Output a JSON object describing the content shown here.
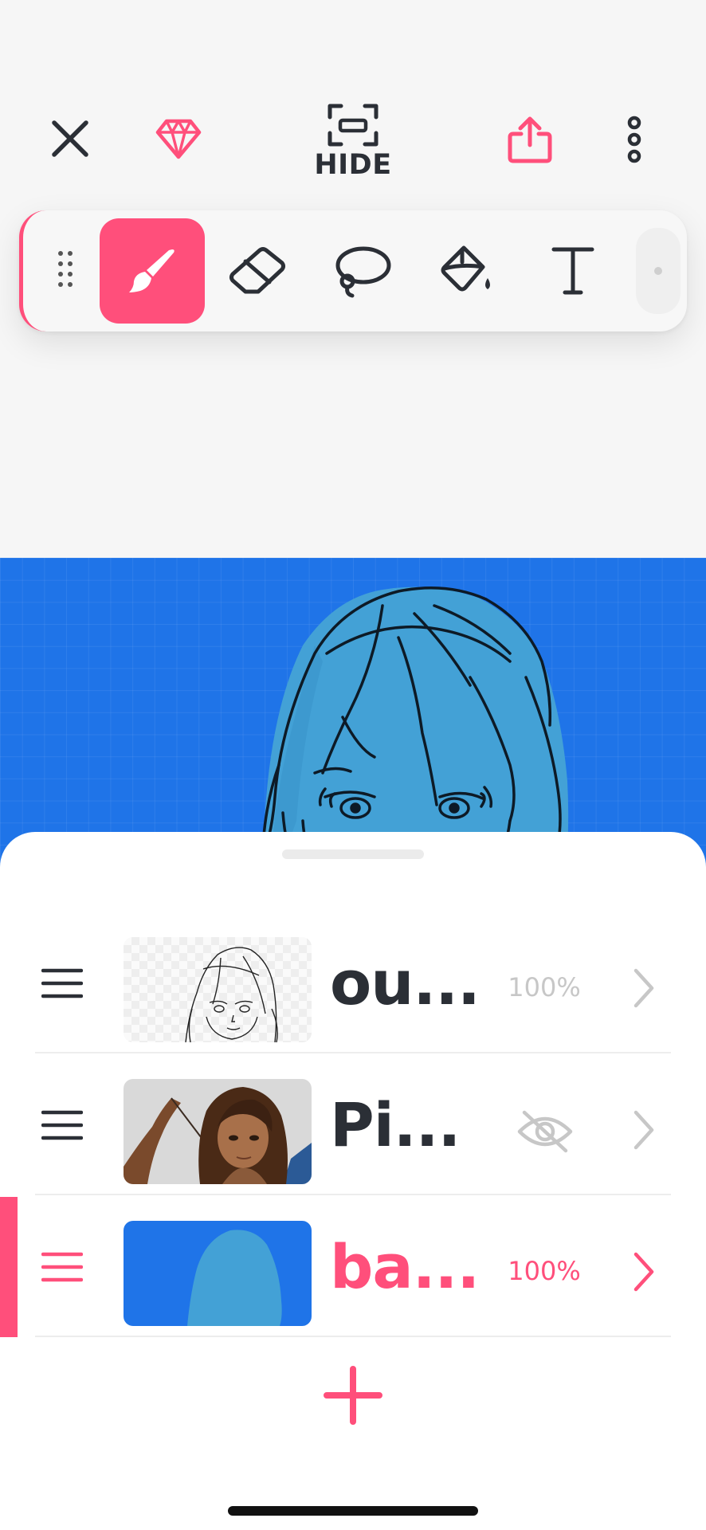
{
  "topbar": {
    "close_icon": "close-icon",
    "premium_icon": "diamond-icon",
    "hide_icon": "fullscreen-icon",
    "hide_label": "HIDE",
    "share_icon": "share-icon",
    "more_icon": "more-vertical-icon"
  },
  "toolbar": {
    "tools": [
      {
        "name": "brush",
        "icon": "brush-icon",
        "active": true
      },
      {
        "name": "eraser",
        "icon": "eraser-icon",
        "active": false
      },
      {
        "name": "lasso",
        "icon": "lasso-icon",
        "active": false
      },
      {
        "name": "fill",
        "icon": "paint-bucket-icon",
        "active": false
      },
      {
        "name": "text",
        "icon": "text-icon",
        "active": false
      }
    ]
  },
  "layers": [
    {
      "name": "ou...",
      "opacity": "100%",
      "visible": true,
      "selected": false,
      "thumb": "outline-sketch"
    },
    {
      "name": "Pi...",
      "opacity": "",
      "visible": false,
      "selected": false,
      "thumb": "character-picture"
    },
    {
      "name": "ba...",
      "opacity": "100%",
      "visible": true,
      "selected": true,
      "thumb": "blue-base"
    }
  ],
  "add_layer_icon": "plus-icon",
  "colors": {
    "accent": "#ff4f7b",
    "canvas_bg": "#1f74e8",
    "hair_fill": "#43a1d6",
    "text_dark": "#2b2f36",
    "muted": "#c7c7c7"
  }
}
